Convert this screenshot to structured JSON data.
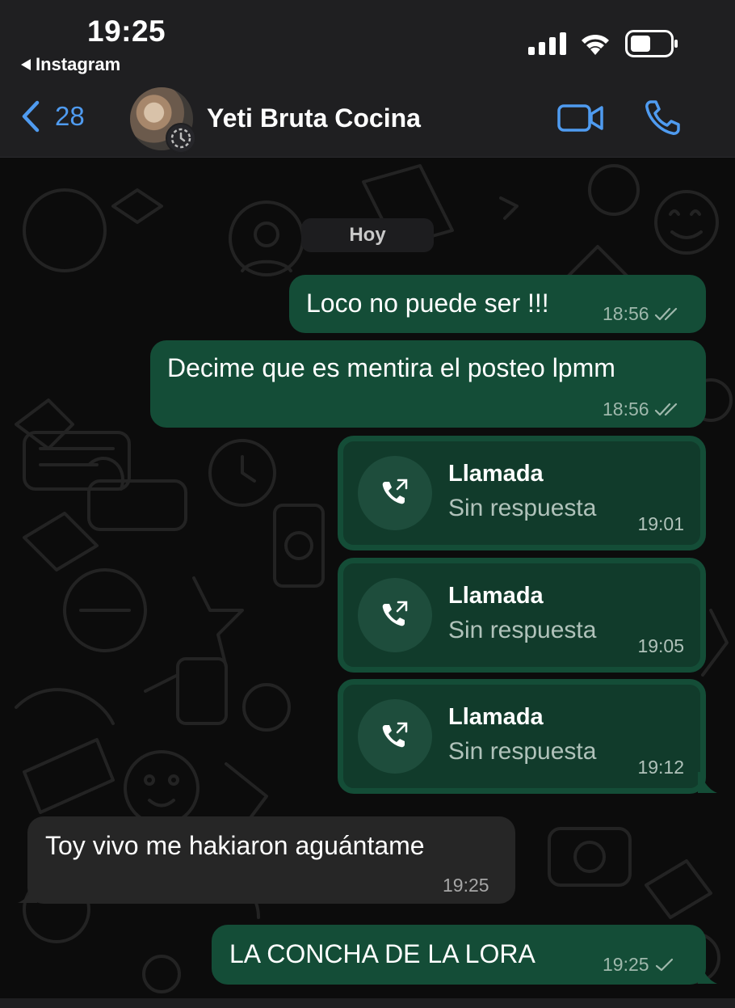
{
  "status_bar": {
    "time": "19:25",
    "back_app": "Instagram"
  },
  "header": {
    "back_count": "28",
    "contact_name": "Yeti Bruta Cocina",
    "accent_color": "#4f9bf0"
  },
  "chat": {
    "day_label": "Hoy",
    "messages": [
      {
        "direction": "out",
        "text": "Loco no puede ser !!!",
        "time": "18:56",
        "status": "read"
      },
      {
        "direction": "out",
        "text": "Decime que es mentira el posteo lpmm",
        "time": "18:56",
        "status": "read"
      },
      {
        "direction": "out",
        "type": "call",
        "title": "Llamada",
        "subtitle": "Sin respuesta",
        "time": "19:01"
      },
      {
        "direction": "out",
        "type": "call",
        "title": "Llamada",
        "subtitle": "Sin respuesta",
        "time": "19:05"
      },
      {
        "direction": "out",
        "type": "call",
        "title": "Llamada",
        "subtitle": "Sin respuesta",
        "time": "19:12"
      },
      {
        "direction": "in",
        "text": "Toy vivo me hakiaron aguántame",
        "time": "19:25"
      },
      {
        "direction": "out",
        "text": "LA CONCHA DE LA LORA",
        "time": "19:25",
        "status": "sent"
      }
    ]
  },
  "colors": {
    "outgoing_bubble": "#144d37",
    "incoming_bubble": "#262626",
    "call_bubble": "#113b2b"
  }
}
